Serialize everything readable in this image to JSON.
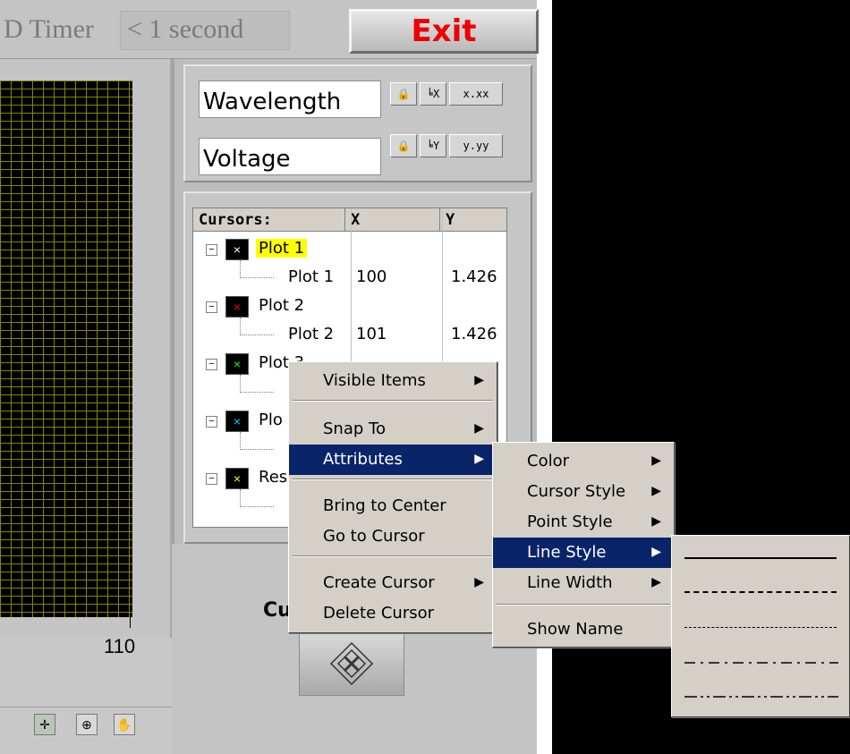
{
  "top": {
    "timer_label": "D Timer",
    "timer_value": "< 1 second",
    "exit_label": "Exit"
  },
  "graph": {
    "x_tick_label": "110",
    "tools": [
      {
        "name": "cursor-tool",
        "icon": "crosshair-icon",
        "glyph": "✛"
      },
      {
        "name": "zoom-tool",
        "icon": "zoom-icon",
        "glyph": "⊕"
      },
      {
        "name": "pan-tool",
        "icon": "hand-icon",
        "glyph": "✋"
      }
    ]
  },
  "scale_legend": {
    "x_name": "Wavelength",
    "y_name": "Voltage",
    "x_buttons": [
      "🔒",
      "ⁱᴸᵡ",
      "x.xx"
    ],
    "y_buttons": [
      "🔒",
      "ⁱᴸʸ",
      "y.yy"
    ]
  },
  "cursor_legend": {
    "headers": [
      "Cursors:",
      "X",
      "Y"
    ],
    "rows": [
      {
        "type": "cursor",
        "label": "Plot 1",
        "swatch_color": "#ffffff",
        "highlight": true
      },
      {
        "type": "point",
        "label": "Plot 1",
        "x": "100",
        "y": "1.426"
      },
      {
        "type": "cursor",
        "label": "Plot 2",
        "swatch_color": "#ff0000",
        "highlight": false
      },
      {
        "type": "point",
        "label": "Plot 2",
        "x": "101",
        "y": "1.426"
      },
      {
        "type": "cursor",
        "label": "Plot 3",
        "swatch_color": "#00ff00",
        "highlight": false
      },
      {
        "type": "point",
        "label": "",
        "x": "",
        "y": ""
      },
      {
        "type": "cursor",
        "label": "Plo",
        "swatch_color": "#00c8ff",
        "highlight": false
      },
      {
        "type": "point",
        "label": "",
        "x": "",
        "y": ""
      },
      {
        "type": "cursor",
        "label": "Res",
        "swatch_color": "#ffff00",
        "highlight": false
      },
      {
        "type": "point",
        "label": "",
        "x": "",
        "y": ""
      }
    ],
    "below_label": "Cu"
  },
  "context_menu": {
    "items": [
      "Visible Items",
      "Snap To",
      "Attributes",
      "Bring to Center",
      "Go to Cursor",
      "Create Cursor",
      "Delete Cursor"
    ],
    "selected": "Attributes"
  },
  "attributes_menu": {
    "items": [
      "Color",
      "Cursor Style",
      "Point Style",
      "Line Style",
      "Line Width",
      "Show Name"
    ],
    "selected": "Line Style"
  },
  "line_style_menu": {
    "styles": [
      "solid",
      "long-dash",
      "dotted",
      "dash-dot",
      "dash-dot-dot"
    ]
  },
  "colors": {
    "exit_text": "#ee0000",
    "menu_highlight": "#0a246a",
    "plot1_highlight": "#ffff00",
    "grid": "#8a8400"
  }
}
